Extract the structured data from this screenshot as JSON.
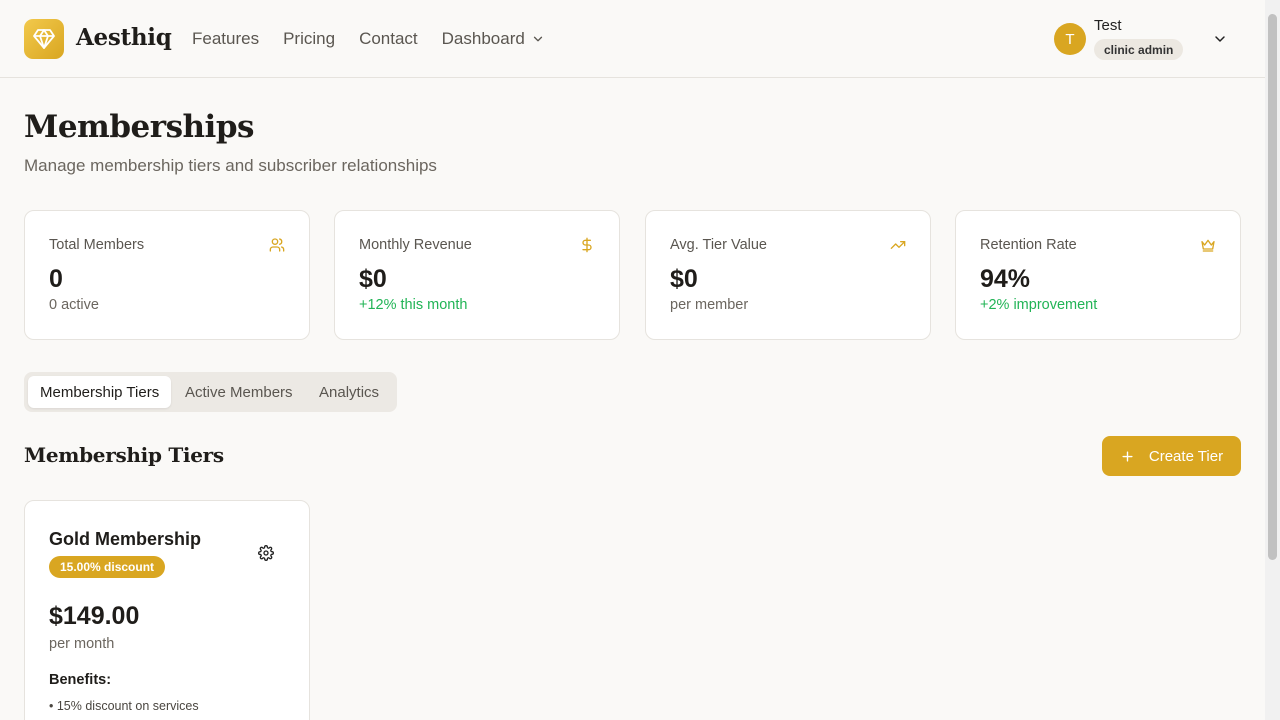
{
  "header": {
    "brand": "Aesthiq",
    "nav": [
      {
        "label": "Features"
      },
      {
        "label": "Pricing"
      },
      {
        "label": "Contact"
      },
      {
        "label": "Dashboard"
      }
    ],
    "user": {
      "initial": "T",
      "name": "Test",
      "role": "clinic admin"
    }
  },
  "page": {
    "title": "Memberships",
    "subtitle": "Manage membership tiers and subscriber relationships"
  },
  "stats": [
    {
      "label": "Total Members",
      "icon": "users-icon",
      "value": "0",
      "note": "0 active",
      "note_color": "gray"
    },
    {
      "label": "Monthly Revenue",
      "icon": "dollar-icon",
      "value": "$0",
      "note": "+12% this month",
      "note_color": "green"
    },
    {
      "label": "Avg. Tier Value",
      "icon": "trending-up-icon",
      "value": "$0",
      "note": "per member",
      "note_color": "gray"
    },
    {
      "label": "Retention Rate",
      "icon": "crown-icon",
      "value": "94%",
      "note": "+2% improvement",
      "note_color": "green"
    }
  ],
  "tabs": [
    {
      "label": "Membership Tiers",
      "active": true
    },
    {
      "label": "Active Members",
      "active": false
    },
    {
      "label": "Analytics",
      "active": false
    }
  ],
  "section": {
    "title": "Membership Tiers",
    "create_label": "Create Tier"
  },
  "tier": {
    "name": "Gold Membership",
    "discount": "15.00% discount",
    "price": "$149.00",
    "period": "per month",
    "benefits_heading": "Benefits:",
    "benefits": [
      "• 15% discount on services"
    ]
  },
  "colors": {
    "accent": "#d9a621",
    "green": "#22b456",
    "background": "#faf9f7"
  }
}
